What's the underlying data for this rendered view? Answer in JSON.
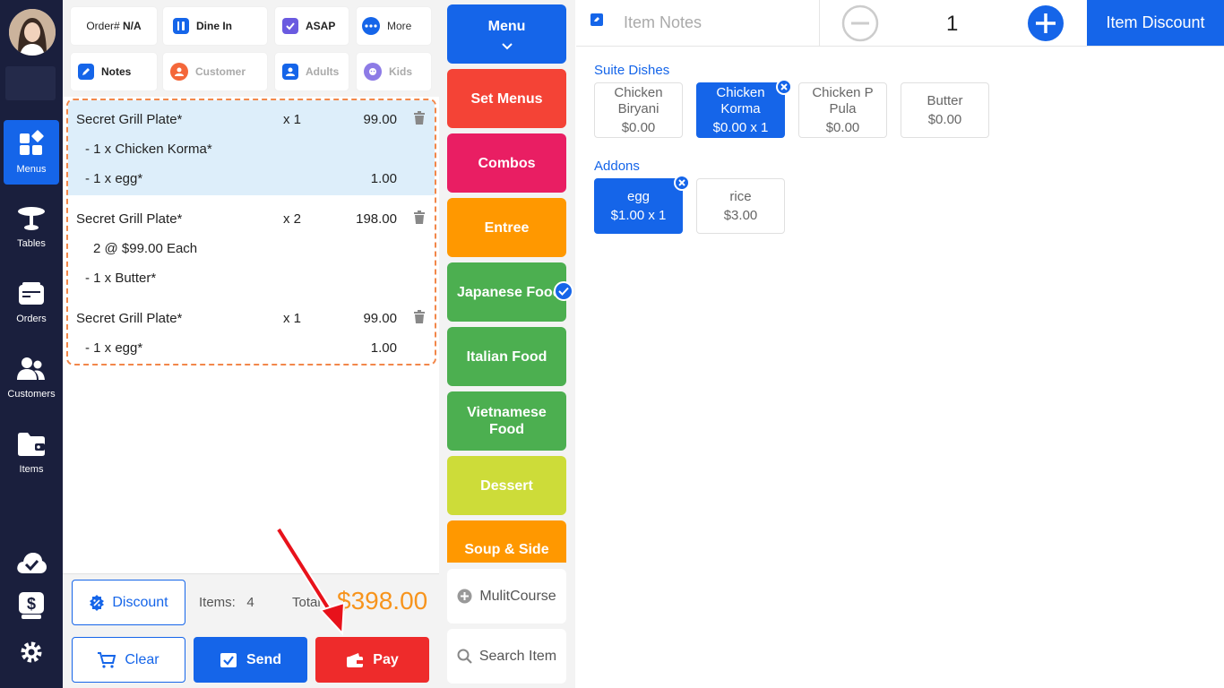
{
  "sidebar": {
    "items": [
      {
        "label": "Menus",
        "icon": "grid-icon",
        "active": true
      },
      {
        "label": "Tables",
        "icon": "table-icon",
        "active": false
      },
      {
        "label": "Orders",
        "icon": "orders-icon",
        "active": false
      },
      {
        "label": "Customers",
        "icon": "customers-icon",
        "active": false
      },
      {
        "label": "Items",
        "icon": "folder-icon",
        "active": false
      }
    ],
    "bottom_icons": [
      "cloud-check-icon",
      "cash-register-icon",
      "gear-icon"
    ]
  },
  "order_header": {
    "order_label": "Order#",
    "order_value": "N/A",
    "dine_in": "Dine In",
    "asap": "ASAP",
    "more": "More",
    "notes": "Notes",
    "customer": "Customer",
    "adults": "Adults",
    "kids": "Kids"
  },
  "order_items": [
    {
      "name": "Secret Grill Plate*",
      "qty": "x 1",
      "price": "99.00",
      "mods": [
        {
          "text": "- 1 x Chicken Korma*",
          "price": ""
        },
        {
          "text": "- 1 x egg*",
          "price": "1.00"
        }
      ]
    },
    {
      "name": "Secret Grill Plate*",
      "qty": "x 2",
      "price": "198.00",
      "mods": [
        {
          "text": "2 @ $99.00 Each",
          "price": ""
        },
        {
          "text": "- 1 x Butter*",
          "price": ""
        }
      ]
    },
    {
      "name": "Secret Grill Plate*",
      "qty": "x 1",
      "price": "99.00",
      "mods": [
        {
          "text": "- 1 x egg*",
          "price": "1.00"
        }
      ]
    }
  ],
  "summary": {
    "discount_label": "Discount",
    "items_label": "Items:",
    "items_count": "4",
    "total_label": "Total",
    "total_value": "$398.00"
  },
  "actions": {
    "clear": "Clear",
    "send": "Send",
    "pay": "Pay"
  },
  "categories": [
    {
      "label": "Menu",
      "color": "#1565e9"
    },
    {
      "label": "Set Menus",
      "color": "#f44336"
    },
    {
      "label": "Combos",
      "color": "#e91e63"
    },
    {
      "label": "Entree",
      "color": "#ff9800"
    },
    {
      "label": "Japanese Food",
      "color": "#4caf50",
      "checked": true
    },
    {
      "label": "Italian Food",
      "color": "#4caf50"
    },
    {
      "label": "Vietnamese Food",
      "color": "#4caf50"
    },
    {
      "label": "Dessert",
      "color": "#cddc39"
    },
    {
      "label": "Soup & Side",
      "color": "#ff9800"
    }
  ],
  "utility": {
    "multicourse": "MulitCourse",
    "search": "Search Item"
  },
  "item_panel": {
    "notes_placeholder": "Item Notes",
    "quantity": "1",
    "item_discount": "Item Discount",
    "suite_title": "Suite Dishes",
    "suite_options": [
      {
        "name": "Chicken Biryani",
        "price": "$0.00",
        "selected": false
      },
      {
        "name": "Chicken Korma",
        "price": "$0.00 x 1",
        "selected": true
      },
      {
        "name": "Chicken P Pula",
        "price": "$0.00",
        "selected": false
      },
      {
        "name": "Butter",
        "price": "$0.00",
        "selected": false
      }
    ],
    "addons_title": "Addons",
    "addon_options": [
      {
        "name": "egg",
        "price": "$1.00 x 1",
        "selected": true
      },
      {
        "name": "rice",
        "price": "$3.00",
        "selected": false
      }
    ]
  },
  "colors": {
    "sidebar_bg": "#1a1f3d",
    "accent": "#1565e9",
    "total": "#f7941d",
    "pay": "#ee2b2b",
    "selection_outline": "#f2874a"
  }
}
